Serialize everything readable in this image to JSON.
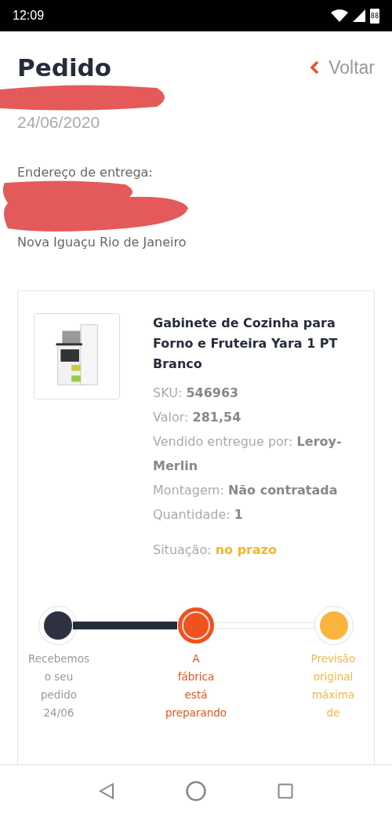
{
  "status_bar": {
    "time": "12:09",
    "battery": "88"
  },
  "header": {
    "title": "Pedido",
    "back": "Voltar"
  },
  "order": {
    "number_redacted": true,
    "date": "24/06/2020"
  },
  "address": {
    "label": "Endereço de entrega:",
    "lines_redacted": true,
    "city": "Nova Iguaçu Rio de Janeiro"
  },
  "product": {
    "name": "Gabinete de Cozinha para Forno e Fruteira Yara 1 PT Branco",
    "details": [
      {
        "label": "SKU:",
        "value": "546963"
      },
      {
        "label": "Valor:",
        "value": "281,54"
      },
      {
        "label": "Vendido entregue por:",
        "value": "Leroy-Merlin"
      },
      {
        "label": "Montagem:",
        "value": "Não contratada"
      },
      {
        "label": "Quantidade:",
        "value": "1"
      }
    ],
    "status": {
      "label": "Situação:",
      "value": "no prazo"
    }
  },
  "timeline": [
    {
      "kind": "done",
      "label": "Recebemos\no seu\npedido\n24/06"
    },
    {
      "kind": "current",
      "label": "A\nfábrica\nestá\npreparando"
    },
    {
      "kind": "pending",
      "label": "Previsão\noriginal\nmáxima\nde"
    }
  ]
}
